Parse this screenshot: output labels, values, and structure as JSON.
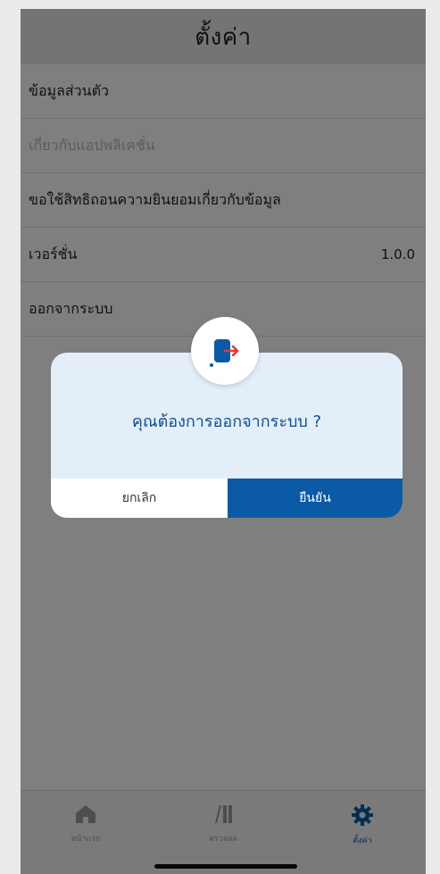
{
  "header": {
    "title": "ตั้งค่า"
  },
  "settings": {
    "items": [
      {
        "label": "ข้อมูลส่วนตัว",
        "enabled": true
      },
      {
        "label": "เกี่ยวกับแอปพลิเคชั่น",
        "enabled": false
      },
      {
        "label": "ขอใช้สิทธิถอนความยินยอมเกี่ยวกับข้อมูล",
        "enabled": true
      },
      {
        "label": "เวอร์ชั่น",
        "value": "1.0.0",
        "enabled": true
      },
      {
        "label": "ออกจากระบบ",
        "enabled": true
      }
    ]
  },
  "dialog": {
    "icon": "logout-icon",
    "message": "คุณต้องการออกจากระบบ ?",
    "cancel_label": "ยกเลิก",
    "confirm_label": "ยืนยัน"
  },
  "tabbar": {
    "tabs": [
      {
        "label": "หน้าแรก",
        "icon": "home-icon",
        "active": false
      },
      {
        "label": "ตรวจผล",
        "icon": "lottery-icon",
        "active": false
      },
      {
        "label": "ตั้งค่า",
        "icon": "gear-icon",
        "active": true
      }
    ]
  },
  "colors": {
    "accent": "#0b5aa6",
    "dialog_bg": "#e3eef8",
    "message_text": "#0b4f94",
    "logout_arrow": "#e53935",
    "overlay": "rgba(0,0,0,0.5)"
  }
}
